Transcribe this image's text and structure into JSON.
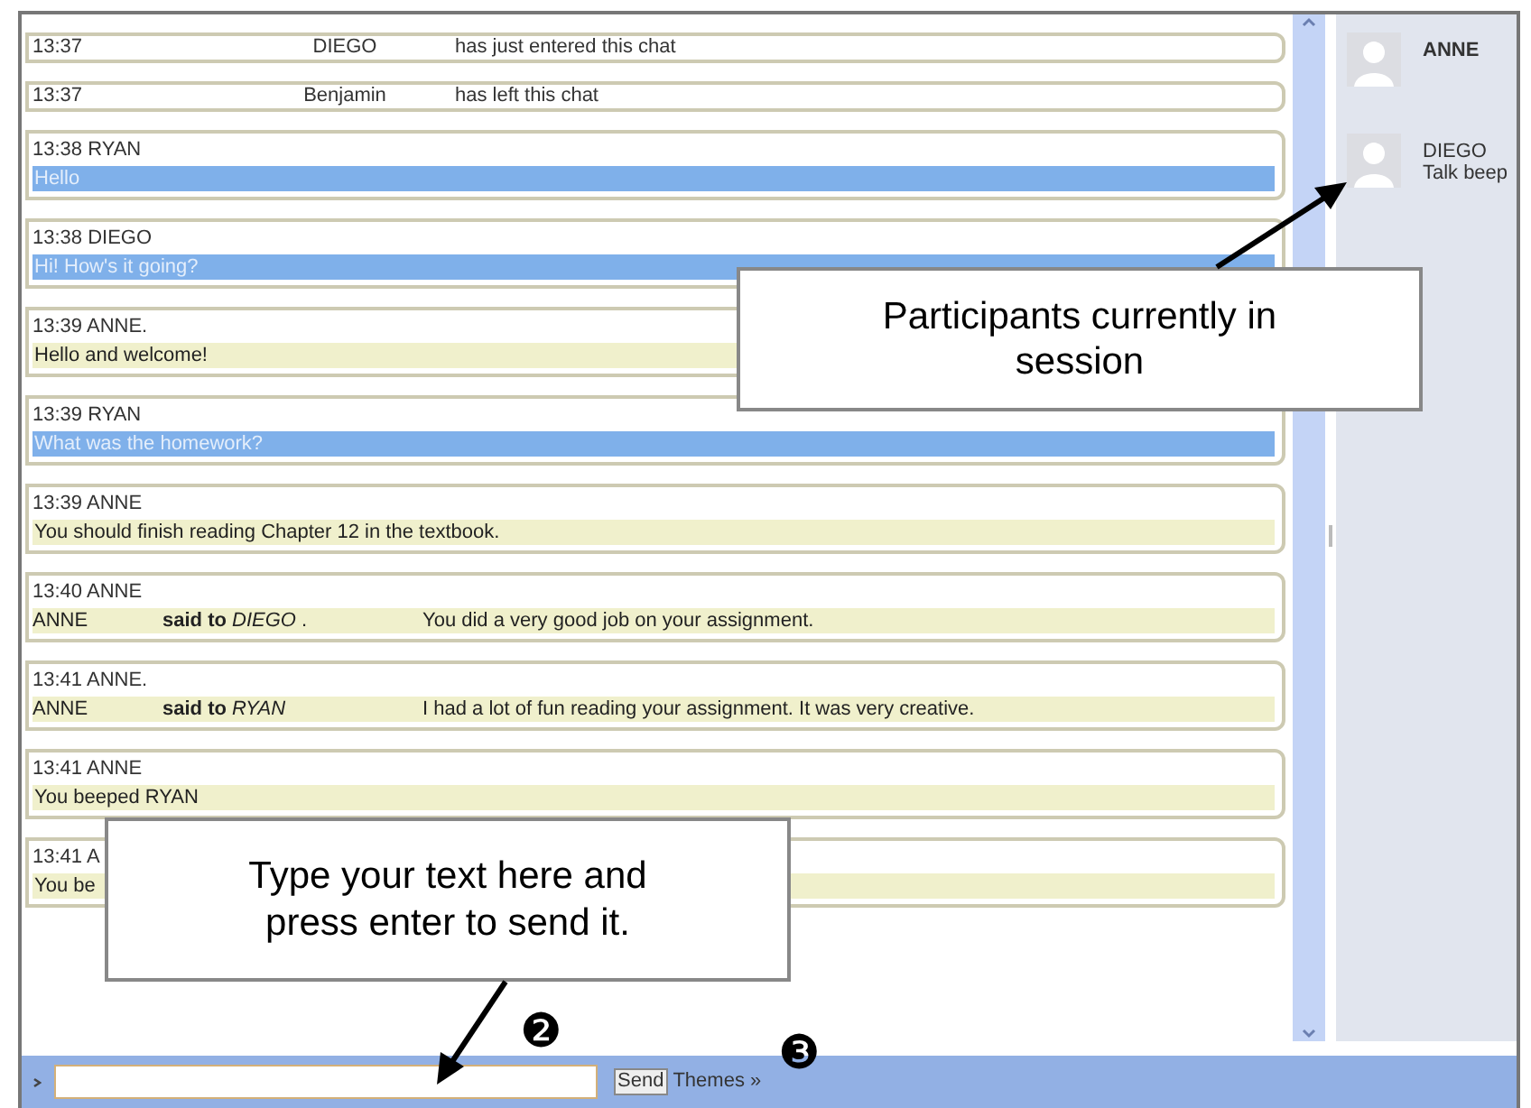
{
  "messages": [
    {
      "kind": "system",
      "time": "13:37",
      "name": "DIEGO",
      "text": "has just entered this chat"
    },
    {
      "kind": "system",
      "time": "13:37",
      "name": "Benjamin",
      "text": "has left this chat"
    },
    {
      "kind": "message",
      "header": "13:38 RYAN",
      "text": "Hello",
      "color": "#7fb0ea"
    },
    {
      "kind": "message",
      "header": "13:38 DIEGO",
      "text": "Hi! How's it going?",
      "color": "#7fb0ea"
    },
    {
      "kind": "message",
      "header": "13:39 ANNE.",
      "text": "Hello and welcome!",
      "color": "#f0f0cc"
    },
    {
      "kind": "message",
      "header": "13:39 RYAN",
      "text": "What was the homework?",
      "color": "#7fb0ea"
    },
    {
      "kind": "message",
      "header": "13:39 ANNE",
      "text": "You should finish reading Chapter 12 in the textbook.",
      "color": "#f0f0cc"
    },
    {
      "kind": "private",
      "header": "13:40 ANNE",
      "sender": "ANNE",
      "said_to": "**said to** *DIEGO* .",
      "text": "You did a very good job on your assignment.",
      "color": "#f0f0cc"
    },
    {
      "kind": "private",
      "header": "13:41 ANNE.",
      "sender": "ANNE",
      "said_to": "**said to** *RYAN*",
      "text": "I had a lot of fun reading your assignment. It was very creative.",
      "color": "#f0f0cc"
    },
    {
      "kind": "message",
      "header": "13:41 ANNE",
      "text": "You beeped RYAN",
      "color": "#f0f0cc"
    },
    {
      "kind": "message",
      "header": "13:41 A",
      "text": "You be",
      "color": "#f0f0cc"
    }
  ],
  "participants": [
    {
      "name": "ANNE",
      "is_self": true
    },
    {
      "name": "DIEGO",
      "is_self": false,
      "actions": [
        "Talk",
        "beep"
      ]
    }
  ],
  "input_bar": {
    "send": "Send",
    "themes": "Themes »"
  },
  "markers": [
    "❷",
    "❸"
  ],
  "callouts": [
    {
      "kind": "participants",
      "text": "Participants currently in session"
    },
    {
      "kind": "input",
      "text": "Type your text here and press enter to send it."
    }
  ]
}
